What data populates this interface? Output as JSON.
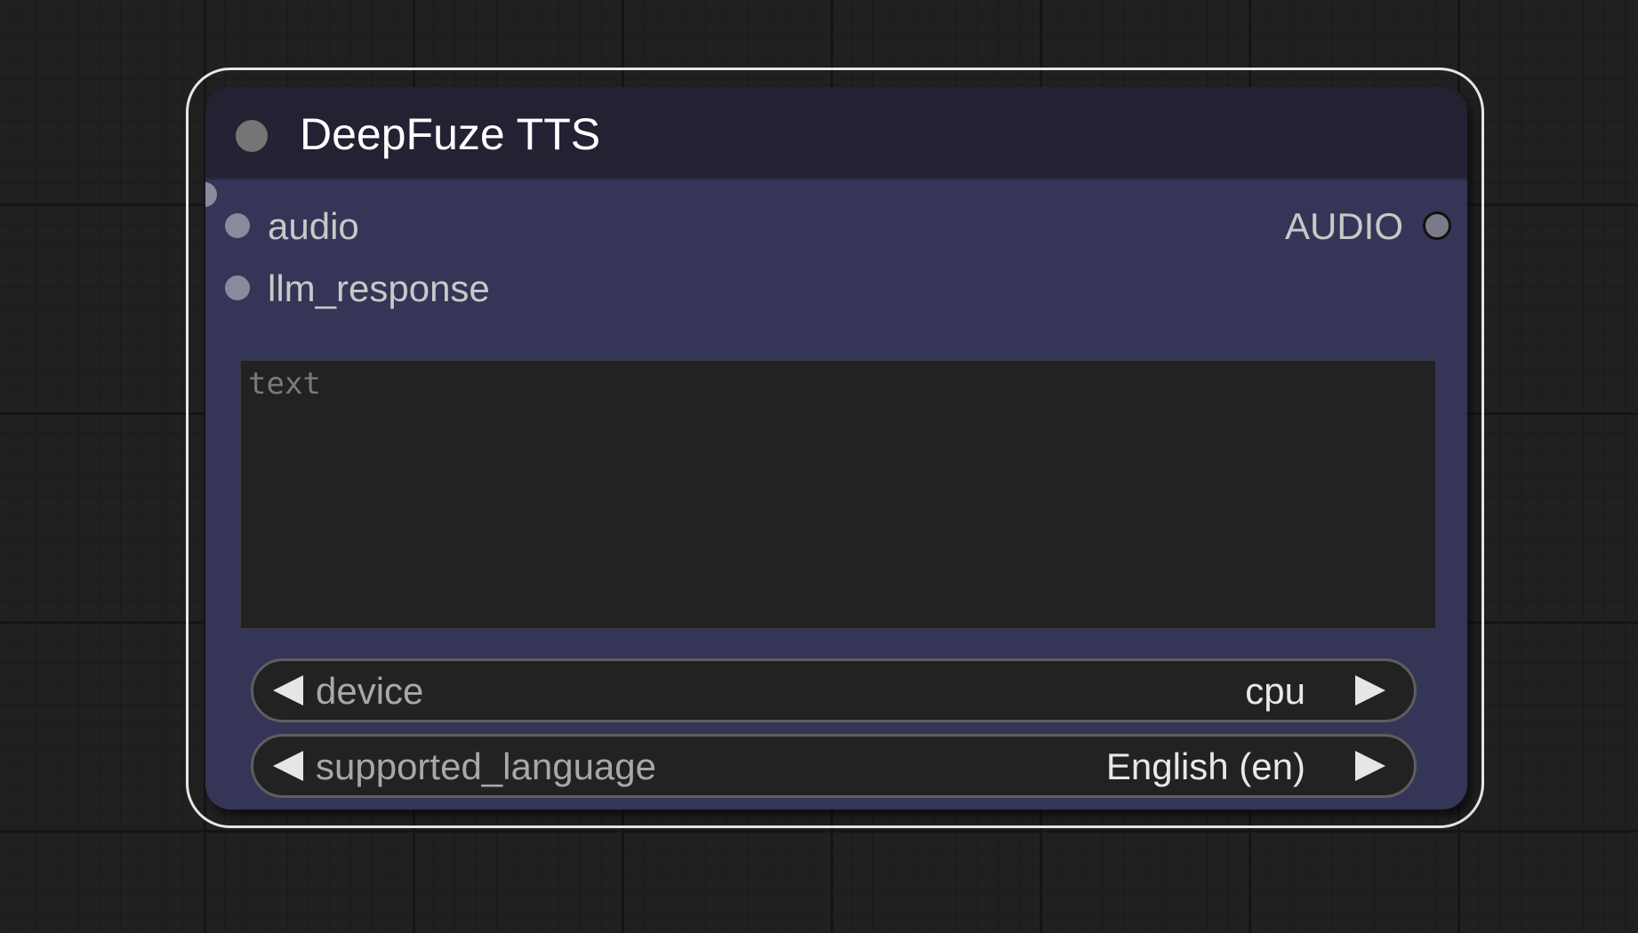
{
  "node": {
    "title": "DeepFuze TTS",
    "inputs": [
      {
        "label": "audio"
      },
      {
        "label": "llm_response"
      }
    ],
    "outputs": [
      {
        "label": "AUDIO"
      }
    ],
    "text_widget": {
      "placeholder": "text",
      "value": ""
    },
    "combos": [
      {
        "label": "device",
        "value": "cpu"
      },
      {
        "label": "supported_language",
        "value": "English (en)"
      }
    ]
  },
  "colors": {
    "canvas_bg": "#202020",
    "node_body": "#353558",
    "node_title_bar": "#222233",
    "selection_outline": "#e6e6e6",
    "widget_bg": "#222222"
  },
  "icons": {
    "title_dot": "collapse-dot-icon",
    "input_slot": "input-slot-dot-icon",
    "output_slot": "output-slot-dot-icon",
    "combo_left": "arrow-left-icon",
    "combo_right": "arrow-right-icon"
  }
}
